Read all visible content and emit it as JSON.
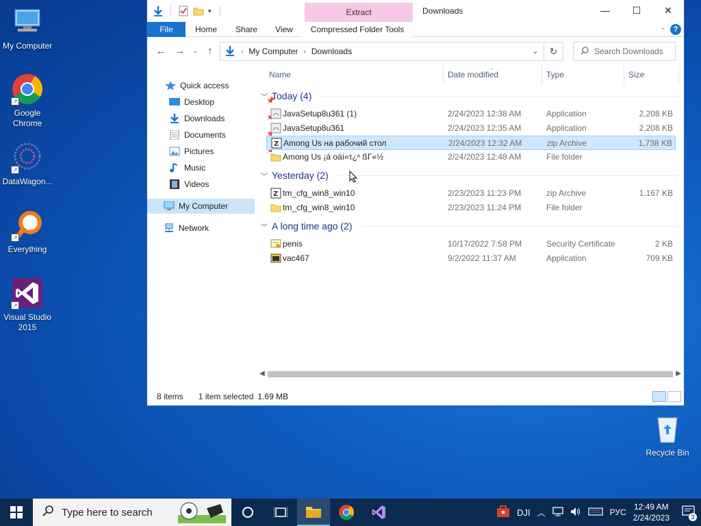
{
  "desktop": {
    "icons": [
      {
        "label": "My Computer"
      },
      {
        "label": "Google Chrome"
      },
      {
        "label": "DataWagon..."
      },
      {
        "label": "Everything"
      },
      {
        "label": "Visual Studio 2015"
      },
      {
        "label": "Recycle Bin"
      }
    ]
  },
  "window": {
    "title": "Downloads",
    "contextual_tab": "Extract",
    "ribbon_tabs": [
      "File",
      "Home",
      "Share",
      "View",
      "Compressed Folder Tools"
    ],
    "address": {
      "root": "My Computer",
      "current": "Downloads"
    },
    "search_placeholder": "Search Downloads",
    "caption": {
      "minimize": "—",
      "maximize": "☐",
      "close": "✕"
    }
  },
  "nav_pane": {
    "quick_access": "Quick access",
    "items": [
      "Desktop",
      "Downloads",
      "Documents",
      "Pictures",
      "Music",
      "Videos"
    ],
    "my_computer": "My Computer",
    "network": "Network"
  },
  "columns": {
    "name": "Name",
    "date": "Date modified",
    "type": "Type",
    "size": "Size"
  },
  "groups": [
    {
      "label": "Today (4)",
      "files": [
        {
          "name": "JavaSetup8u361 (1)",
          "date": "2/24/2023 12:38 AM",
          "type": "Application",
          "size": "2,208 KB",
          "icon": "java-installer-icon"
        },
        {
          "name": "JavaSetup8u361",
          "date": "2/24/2023 12:35 AM",
          "type": "Application",
          "size": "2,208 KB",
          "icon": "java-installer-icon"
        },
        {
          "name": "Among Us на рабочий стол",
          "date": "2/24/2023 12:32 AM",
          "type": "zip Archive",
          "size": "1,738 KB",
          "icon": "zip-archive-icon",
          "selected": true
        },
        {
          "name": "Among Us ¡á οáí«τ¿ⁿ ßΓ«½",
          "date": "2/24/2023 12:48 AM",
          "type": "File folder",
          "size": "",
          "icon": "folder-icon"
        }
      ]
    },
    {
      "label": "Yesterday (2)",
      "files": [
        {
          "name": "tm_cfg_win8_win10",
          "date": "2/23/2023 11:23 PM",
          "type": "zip Archive",
          "size": "1,167 KB",
          "icon": "zip-archive-icon"
        },
        {
          "name": "tm_cfg_win8_win10",
          "date": "2/23/2023 11:24 PM",
          "type": "File folder",
          "size": "",
          "icon": "folder-icon"
        }
      ]
    },
    {
      "label": "A long time ago (2)",
      "files": [
        {
          "name": "penis",
          "date": "10/17/2022 7:58 PM",
          "type": "Security Certificate",
          "size": "2 KB",
          "icon": "certificate-icon"
        },
        {
          "name": "vac467",
          "date": "9/2/2022 11:37 AM",
          "type": "Application",
          "size": "709 KB",
          "icon": "application-icon"
        }
      ]
    }
  ],
  "status": {
    "items": "8 items",
    "selected": "1 item selected",
    "size": "1.69 MB"
  },
  "taskbar": {
    "search_placeholder": "Type here to search",
    "tray_app": "DJI",
    "language": "РУС",
    "time": "12:49 AM",
    "date": "2/24/2023",
    "notifications": "3"
  },
  "colors": {
    "accent": "#1a73d0",
    "selection": "#cce8ff",
    "group_header": "#1e3287",
    "taskbar": "#0b2a4f"
  }
}
